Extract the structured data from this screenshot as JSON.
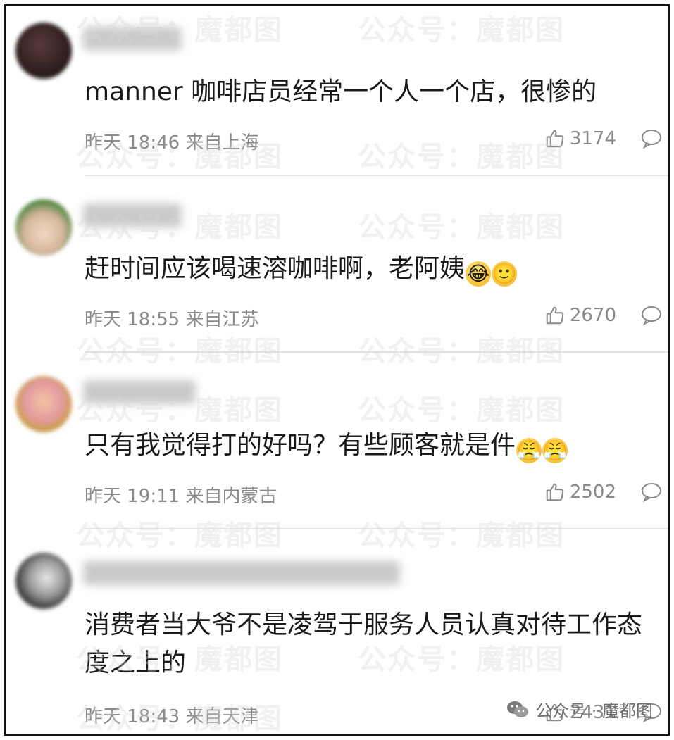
{
  "watermark": "公众号：魔都图",
  "brand": {
    "label": "公众号 · 魔都图"
  },
  "comments": [
    {
      "content": "manner 咖啡店员经常一个人一个店，很惨的",
      "emojis": [],
      "time": "昨天 18:46 来自上海",
      "likes": "3174"
    },
    {
      "content": "赶时间应该喝速溶咖啡啊，老阿姨",
      "emojis": [
        "😂",
        "🙂"
      ],
      "time": "昨天 18:55 来自江苏",
      "likes": "2670"
    },
    {
      "content": "只有我觉得打的好吗？有些顾客就是件",
      "emojis": [
        "😤",
        "😤"
      ],
      "time": "昨天 19:11 来自内蒙古",
      "likes": "2502"
    },
    {
      "content": "消费者当大爷不是凌驾于服务人员认真对待工作态度之上的",
      "emojis": [],
      "time": "昨天 18:43 来自天津",
      "likes": "2431"
    }
  ],
  "colors": {
    "text": "#1a1a1a",
    "meta": "#8a8a8a",
    "divider": "#e2e2e2",
    "border": "#111111"
  },
  "icons": {
    "like": "thumbs-up-icon",
    "reply": "speech-bubble-icon",
    "brand": "wechat-icon"
  }
}
